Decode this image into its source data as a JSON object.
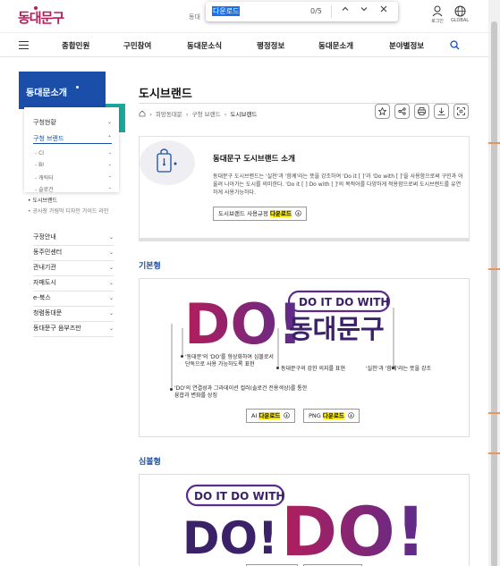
{
  "header": {
    "logo_text": "동대문구",
    "gray_text": "동대",
    "login_label": "로그인",
    "global_label": "GLOBAL"
  },
  "find_bar": {
    "query": "다운로드",
    "count": "0/5",
    "up_icon": "chevron-up-icon",
    "down_icon": "chevron-down-icon",
    "close_icon": "close-icon"
  },
  "nav": {
    "items": [
      "종합민원",
      "구민참여",
      "동대문소식",
      "행정정보",
      "동대문소개",
      "분야별정보"
    ]
  },
  "sidebar": {
    "hero_title": "동대문소개",
    "items": [
      {
        "label": "구청현황"
      },
      {
        "label": "구청 브랜드"
      }
    ],
    "sub_items": [
      "CI",
      "BI",
      "캐릭터",
      "슬로건"
    ],
    "bullet_items": [
      "도시브랜드",
      "공사장 가림막 디자인 가이드 라인"
    ],
    "menu": [
      "구정안내",
      "동주민센터",
      "관내기관",
      "자매도시",
      "e-북스",
      "청렴동대문",
      "동대문구 음부즈만"
    ]
  },
  "main": {
    "page_title": "도시브랜드",
    "breadcrumb": [
      "희망동대문",
      "구청 브랜드",
      "도시브랜드"
    ],
    "intro": {
      "title": "동대문구 도시브랜드 소개",
      "text": "동대문구 도시브랜드는 '실천'과 '함께'라는 뜻을 강조하여 'Do it [ ]'과 'Do with [ ]'을 사용함으로써 구민과 어울려 나아가는 도시를 의미한다. 'Do it [ ] Do with [ ]'의 목적어를 다양하게 적용함으로써 도시브랜드를 유연하게 사용가능하다.",
      "button_prefix": "도시브랜드 사용규정 ",
      "button_highlight": "다운로드"
    },
    "basic": {
      "title": "기본형",
      "logo_do": "DO!",
      "logo_tag": "DO IT DO WITH",
      "logo_name": "동대문구",
      "notes": [
        "'동대문'의 'DO'를 형상화하여 심볼로서 단독으로 사용 가능하도록 표현",
        "'DO'의 연결성과 그라데이션 컬러(솔로건 전용색상)를 통한 융합과 변화를 상징",
        "동대문구의 강한 의지를 표현",
        "'실천'과 '함께'라는 뜻을 강조"
      ],
      "ai_prefix": "AI ",
      "png_prefix": "PNG ",
      "download_label": "다운로드"
    },
    "symbol": {
      "title": "심볼형",
      "logo_tag": "DO IT DO WITH",
      "logo_do": "DO!",
      "logo_do2": "DO!"
    }
  },
  "colors": {
    "brand_magenta": "#b21e5b",
    "brand_purple": "#5b2c8c",
    "accent_blue": "#1a4ea8",
    "teal": "#19a89b",
    "highlight": "#ffee00"
  }
}
